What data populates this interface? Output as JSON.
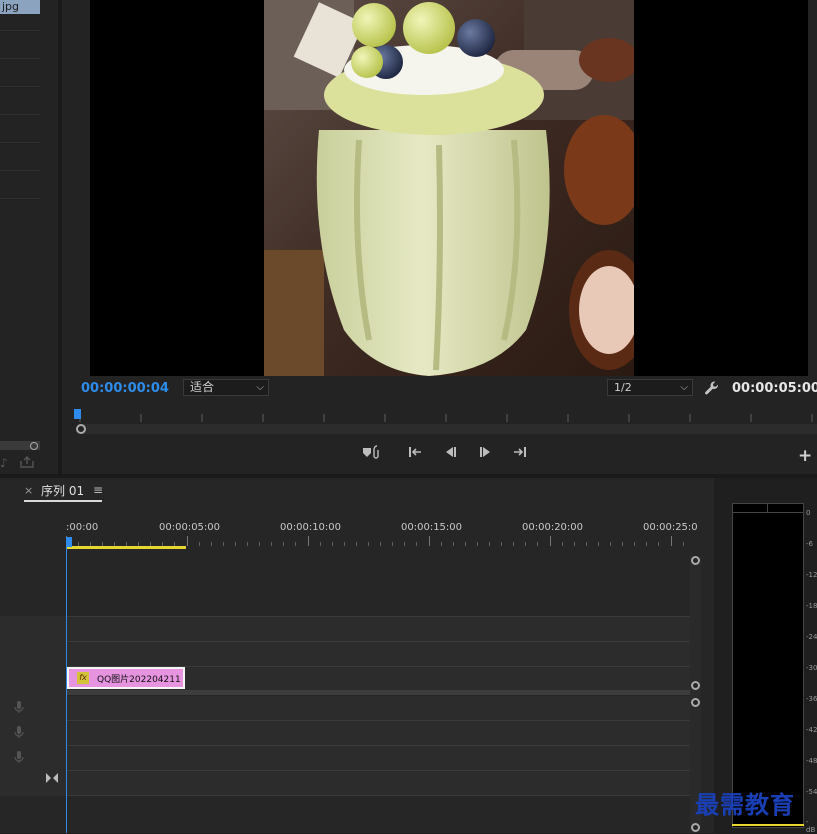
{
  "project_panel": {
    "file_label": "jpg"
  },
  "program_monitor": {
    "current_time": "00:00:00:04",
    "fit": "适合",
    "resolution": "1/2",
    "duration": "00:00:05:00"
  },
  "sequence": {
    "close_glyph": "×",
    "tab_label": "序列 01",
    "menu_glyph": "≡",
    "ruler_labels": [
      ":00:00",
      "00:00:05:00",
      "00:00:10:00",
      "00:00:15:00",
      "00:00:20:00",
      "00:00:25:0"
    ],
    "clip": {
      "fx": "fx",
      "label": "QQ图片202204211"
    }
  },
  "meter_ticks": [
    "0",
    "-6",
    "-12",
    "-18",
    "-24",
    "-30",
    "-36",
    "-42",
    "-48",
    "-54",
    "-dB"
  ],
  "watermark": "最需教育",
  "colors": {
    "accent": "#2d8ceb",
    "clip": "#e693e0",
    "work_area": "#e8d630"
  },
  "icons": [
    "wrench-icon",
    "marker-icon",
    "go-to-in-icon",
    "step-back-icon",
    "step-forward-icon",
    "go-to-out-icon",
    "plus-icon",
    "mic-icon",
    "bowtie-icon"
  ]
}
